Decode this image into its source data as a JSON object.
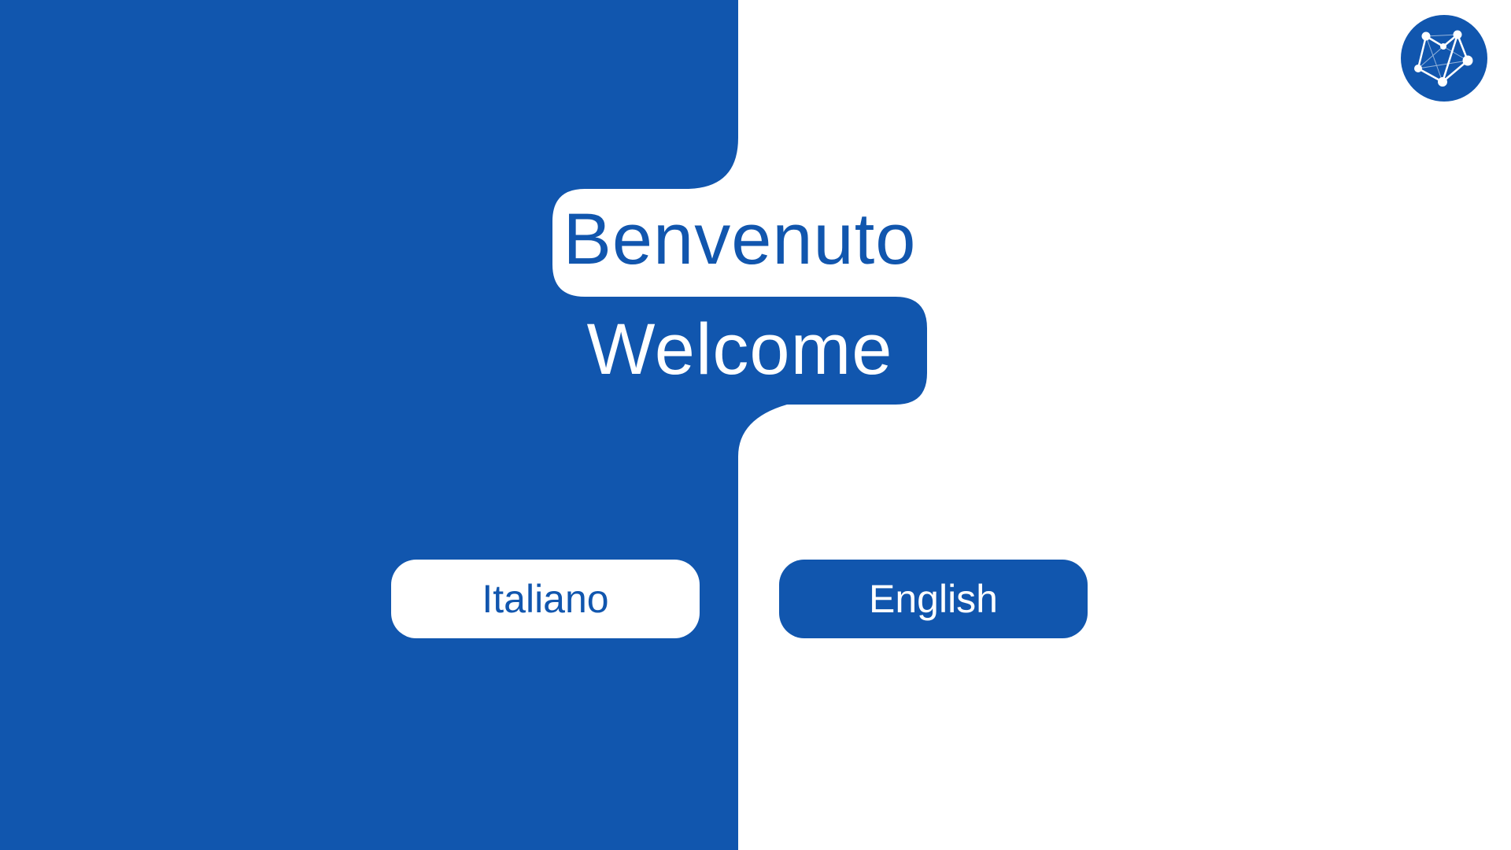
{
  "colors": {
    "brand_blue": "#1156AE",
    "white": "#FFFFFF"
  },
  "logo": {
    "icon": "network-nodes-icon"
  },
  "welcome": {
    "italian": "Benvenuto",
    "english": "Welcome"
  },
  "language_buttons": {
    "italian_label": "Italiano",
    "english_label": "English"
  }
}
